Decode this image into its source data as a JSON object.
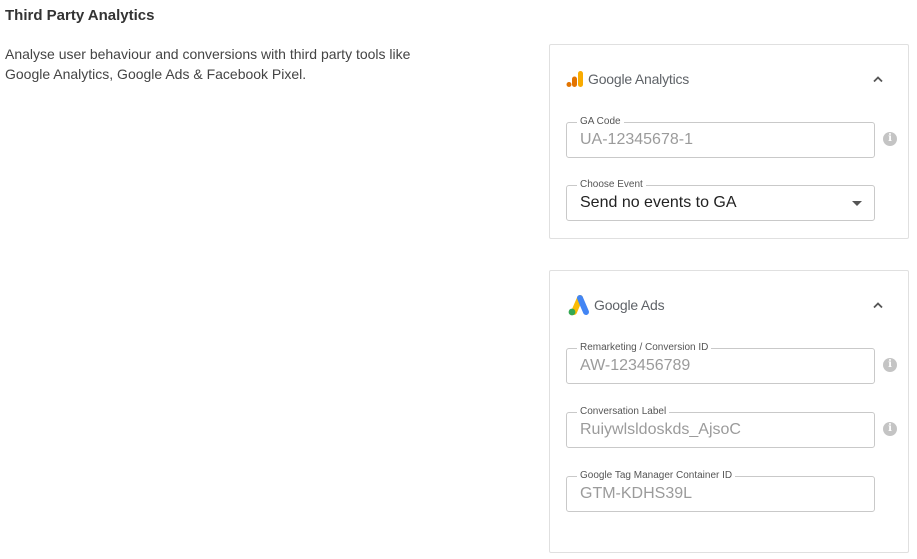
{
  "page": {
    "title": "Third Party Analytics",
    "description": "Analyse user behaviour and conversions with third party tools like Google Analytics, Google Ads & Facebook Pixel."
  },
  "google_analytics": {
    "brand": "Google Analytics",
    "logo_icon": "google-analytics-logo",
    "ga_code": {
      "label": "GA Code",
      "value": "UA-12345678-1"
    },
    "choose_event": {
      "label": "Choose Event",
      "value": "Send no events to GA"
    }
  },
  "google_ads": {
    "brand": "Google Ads",
    "logo_icon": "google-ads-logo",
    "conversion_id": {
      "label": "Remarketing / Conversion ID",
      "value": "AW-123456789"
    },
    "conversation_label": {
      "label": "Conversation Label",
      "value": "Ruiywlsldoskds_AjsoC"
    },
    "gtm_container": {
      "label": "Google Tag Manager Container ID",
      "value": "GTM-KDHS39L"
    }
  },
  "colors": {
    "ga_orange": "#F9AB00",
    "ga_orange_dark": "#E37400",
    "ads_blue": "#4285F4",
    "ads_yellow": "#FBBC04",
    "ads_green": "#34A853"
  }
}
